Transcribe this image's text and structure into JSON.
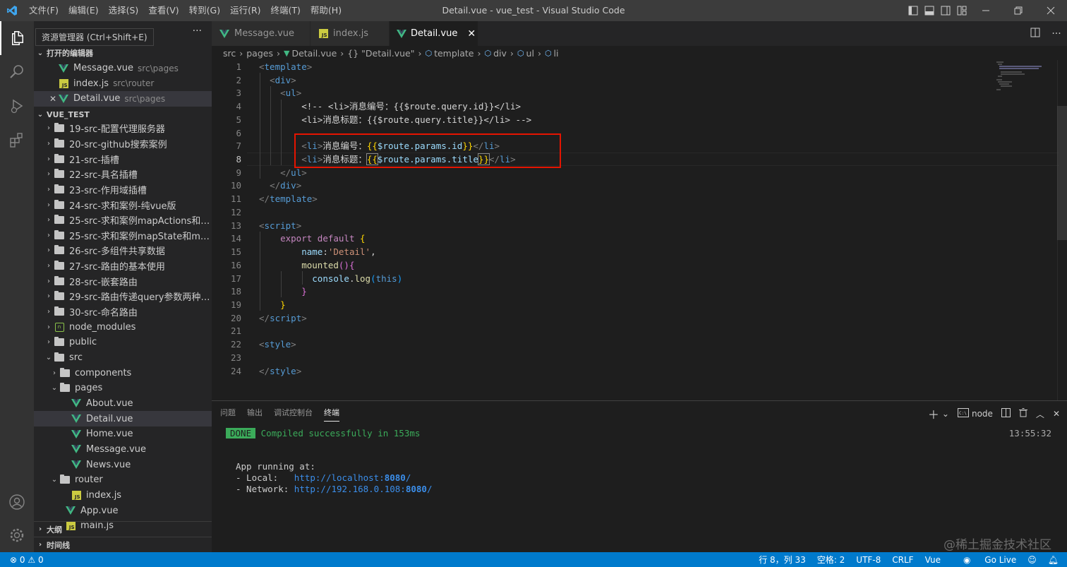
{
  "titlebar": {
    "title": "Detail.vue - vue_test - Visual Studio Code",
    "menu": [
      "文件(F)",
      "编辑(E)",
      "选择(S)",
      "查看(V)",
      "转到(G)",
      "运行(R)",
      "终端(T)",
      "帮助(H)"
    ]
  },
  "activity": {
    "tooltip": "资源管理器 (Ctrl+Shift+E)"
  },
  "sidebar": {
    "open_editors_title": "打开的编辑器",
    "open_editors": [
      {
        "name": "Message.vue",
        "desc": "src\\pages",
        "icon": "vue"
      },
      {
        "name": "index.js",
        "desc": "src\\router",
        "icon": "js"
      },
      {
        "name": "Detail.vue",
        "desc": "src\\pages",
        "icon": "vue"
      }
    ],
    "project_title": "VUE_TEST",
    "tree": [
      {
        "label": "19-src-配置代理服务器",
        "type": "folder",
        "depth": 0
      },
      {
        "label": "20-src-github搜索案例",
        "type": "folder",
        "depth": 0
      },
      {
        "label": "21-src-插槽",
        "type": "folder",
        "depth": 0
      },
      {
        "label": "22-src-具名插槽",
        "type": "folder",
        "depth": 0
      },
      {
        "label": "23-src-作用域插槽",
        "type": "folder",
        "depth": 0
      },
      {
        "label": "24-src-求和案例-纯vue版",
        "type": "folder",
        "depth": 0
      },
      {
        "label": "25-src-求和案例mapActions和ma...",
        "type": "folder",
        "depth": 0
      },
      {
        "label": "25-src-求和案例mapState和map...",
        "type": "folder",
        "depth": 0
      },
      {
        "label": "26-src-多组件共享数据",
        "type": "folder",
        "depth": 0
      },
      {
        "label": "27-src-路由的基本使用",
        "type": "folder",
        "depth": 0
      },
      {
        "label": "28-src-嵌套路由",
        "type": "folder",
        "depth": 0
      },
      {
        "label": "29-src-路由传递query参数两种方...",
        "type": "folder",
        "depth": 0
      },
      {
        "label": "30-src-命名路由",
        "type": "folder",
        "depth": 0
      },
      {
        "label": "node_modules",
        "type": "node",
        "depth": 0
      },
      {
        "label": "public",
        "type": "folder",
        "depth": 0
      },
      {
        "label": "src",
        "type": "folder-open",
        "depth": 0
      },
      {
        "label": "components",
        "type": "folder",
        "depth": 1
      },
      {
        "label": "pages",
        "type": "folder-open",
        "depth": 1
      },
      {
        "label": "About.vue",
        "type": "vue",
        "depth": 2
      },
      {
        "label": "Detail.vue",
        "type": "vue",
        "depth": 2
      },
      {
        "label": "Home.vue",
        "type": "vue",
        "depth": 2
      },
      {
        "label": "Message.vue",
        "type": "vue",
        "depth": 2
      },
      {
        "label": "News.vue",
        "type": "vue",
        "depth": 2
      },
      {
        "label": "router",
        "type": "folder-open",
        "depth": 1
      },
      {
        "label": "index.js",
        "type": "js",
        "depth": 2
      },
      {
        "label": "App.vue",
        "type": "vue",
        "depth": 1
      },
      {
        "label": "main.js",
        "type": "js",
        "depth": 1
      }
    ],
    "outline_title": "大纲",
    "timeline_title": "时间线"
  },
  "tabs": [
    {
      "label": "Message.vue",
      "icon": "vue"
    },
    {
      "label": "index.js",
      "icon": "js"
    },
    {
      "label": "Detail.vue",
      "icon": "vue"
    }
  ],
  "breadcrumb": [
    "src",
    "pages",
    "Detail.vue",
    "{} \"Detail.vue\"",
    "template",
    "div",
    "ul",
    "li"
  ],
  "code_lines": [
    {
      "n": "1"
    },
    {
      "n": "2"
    },
    {
      "n": "3"
    },
    {
      "n": "4"
    },
    {
      "n": "5"
    },
    {
      "n": "6"
    },
    {
      "n": "7"
    },
    {
      "n": "8"
    },
    {
      "n": "9"
    },
    {
      "n": "10"
    },
    {
      "n": "11"
    },
    {
      "n": "12"
    },
    {
      "n": "13"
    },
    {
      "n": "14"
    },
    {
      "n": "15"
    },
    {
      "n": "16"
    },
    {
      "n": "17"
    },
    {
      "n": "18"
    },
    {
      "n": "19"
    },
    {
      "n": "20"
    },
    {
      "n": "21"
    },
    {
      "n": "22"
    },
    {
      "n": "23"
    },
    {
      "n": "24"
    }
  ],
  "code": {
    "l4_comment": "<!-- <li>消息编号：{{$route.query.id}}</li>",
    "l5_comment": "<li>消息标题：{{$route.query.title}}</li> -->",
    "l7_text": "消息编号：",
    "l7_expr": "$route.params.id",
    "l8_text": "消息标题：",
    "l8_expr": "$route.params.title",
    "name_key": "name",
    "name_val": "'Detail'",
    "mounted": "mounted",
    "console": "console",
    "log": "log",
    "this": "this",
    "export": "export",
    "default": "default"
  },
  "panel": {
    "tabs": [
      "问题",
      "输出",
      "调试控制台",
      "终端"
    ],
    "shell": "node",
    "done_badge": "DONE",
    "compiled": "Compiled successfully in 153ms",
    "time": "13:55:32",
    "app_running": "App running at:",
    "local_label": "- Local:   ",
    "local_url": "http://localhost:",
    "local_port": "8080",
    "network_label": "- Network: ",
    "network_url": "http://192.168.0.108:",
    "network_port": "8080"
  },
  "statusbar": {
    "errors": "0",
    "warnings": "0",
    "position": "行 8，列 33",
    "spaces": "空格: 2",
    "encoding": "UTF-8",
    "eol": "CRLF",
    "language": "Vue",
    "golive": "Go Live"
  },
  "watermark": "@稀土掘金技术社区"
}
